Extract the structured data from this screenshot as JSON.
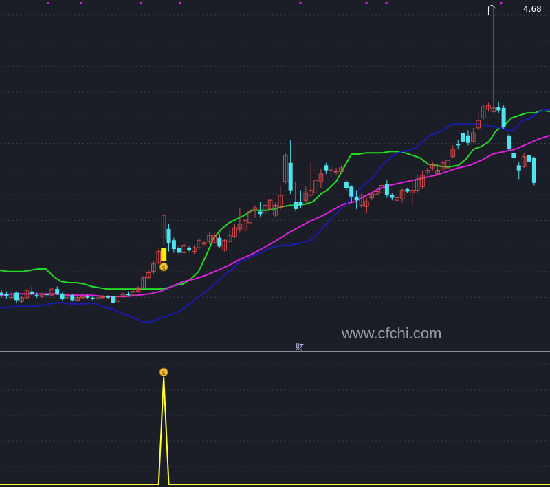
{
  "chart_data": [
    {
      "type": "candlestick",
      "panel": "main",
      "colors": {
        "up": "#d24a4a",
        "down": "#4fe3f0",
        "upper_band": "#22dd22",
        "middle_band": "#e020e0",
        "lower_band": "#1a1ab8",
        "signal_bar": "#ffee00",
        "marker_dots": "#e020e0"
      },
      "candles": [
        [
          2.4,
          2.38,
          2.42,
          2.36
        ],
        [
          2.39,
          2.37,
          2.41,
          2.35
        ],
        [
          2.36,
          2.39,
          2.4,
          2.35
        ],
        [
          2.4,
          2.34,
          2.41,
          2.32
        ],
        [
          2.33,
          2.36,
          2.37,
          2.32
        ],
        [
          2.36,
          2.42,
          2.43,
          2.35
        ],
        [
          2.41,
          2.39,
          2.45,
          2.37
        ],
        [
          2.38,
          2.37,
          2.4,
          2.36
        ],
        [
          2.37,
          2.39,
          2.4,
          2.36
        ],
        [
          2.39,
          2.38,
          2.41,
          2.37
        ],
        [
          2.38,
          2.43,
          2.44,
          2.37
        ],
        [
          2.43,
          2.39,
          2.45,
          2.38
        ],
        [
          2.39,
          2.35,
          2.4,
          2.34
        ],
        [
          2.36,
          2.38,
          2.39,
          2.35
        ],
        [
          2.38,
          2.34,
          2.39,
          2.33
        ],
        [
          2.34,
          2.36,
          2.37,
          2.33
        ],
        [
          2.36,
          2.37,
          2.38,
          2.35
        ],
        [
          2.37,
          2.36,
          2.38,
          2.35
        ],
        [
          2.36,
          2.35,
          2.37,
          2.34
        ],
        [
          2.35,
          2.36,
          2.37,
          2.34
        ],
        [
          2.36,
          2.37,
          2.38,
          2.35
        ],
        [
          2.37,
          2.36,
          2.38,
          2.35
        ],
        [
          2.37,
          2.32,
          2.38,
          2.31
        ],
        [
          2.33,
          2.37,
          2.38,
          2.32
        ],
        [
          2.37,
          2.39,
          2.4,
          2.36
        ],
        [
          2.39,
          2.38,
          2.41,
          2.37
        ],
        [
          2.38,
          2.41,
          2.42,
          2.37
        ],
        [
          2.41,
          2.44,
          2.45,
          2.4
        ],
        [
          2.44,
          2.52,
          2.53,
          2.43
        ],
        [
          2.52,
          2.56,
          2.58,
          2.51
        ],
        [
          2.57,
          2.63,
          2.65,
          2.55
        ],
        [
          2.64,
          2.73,
          2.75,
          2.63
        ],
        [
          2.83,
          3.02,
          3.04,
          2.78
        ],
        [
          2.91,
          2.8,
          2.95,
          2.73
        ],
        [
          2.82,
          2.75,
          2.84,
          2.72
        ],
        [
          2.76,
          2.72,
          2.78,
          2.7
        ],
        [
          2.72,
          2.78,
          2.8,
          2.71
        ],
        [
          2.76,
          2.74,
          2.77,
          2.73
        ],
        [
          2.73,
          2.76,
          2.78,
          2.71
        ],
        [
          2.76,
          2.82,
          2.84,
          2.74
        ],
        [
          2.79,
          2.8,
          2.81,
          2.78
        ],
        [
          2.81,
          2.86,
          2.88,
          2.79
        ],
        [
          2.8,
          2.86,
          2.88,
          2.79
        ],
        [
          2.84,
          2.77,
          2.87,
          2.76
        ],
        [
          2.74,
          2.82,
          2.83,
          2.73
        ],
        [
          2.81,
          2.86,
          2.9,
          2.8
        ],
        [
          2.85,
          2.92,
          2.95,
          2.84
        ],
        [
          2.91,
          2.95,
          3.08,
          2.88
        ],
        [
          2.9,
          2.98,
          2.99,
          2.9
        ],
        [
          2.96,
          3.05,
          3.08,
          2.94
        ],
        [
          3.06,
          3.08,
          3.1,
          3.0
        ],
        [
          3.05,
          3.03,
          3.13,
          3.01
        ],
        [
          3.04,
          3.1,
          3.11,
          3.03
        ],
        [
          3.07,
          3.14,
          3.15,
          3.06
        ],
        [
          3.02,
          3.1,
          3.12,
          3.01
        ],
        [
          3.08,
          3.18,
          3.25,
          3.06
        ],
        [
          3.29,
          3.5,
          3.52,
          3.27
        ],
        [
          3.44,
          3.22,
          3.62,
          3.19
        ],
        [
          3.13,
          3.07,
          3.29,
          3.05
        ],
        [
          3.13,
          3.1,
          3.22,
          3.08
        ],
        [
          3.14,
          3.2,
          3.25,
          3.12
        ],
        [
          3.18,
          3.22,
          3.45,
          3.16
        ],
        [
          3.2,
          3.3,
          3.44,
          3.19
        ],
        [
          3.29,
          3.35,
          3.39,
          3.24
        ],
        [
          3.42,
          3.38,
          3.44,
          3.35
        ],
        [
          3.38,
          3.39,
          3.42,
          3.32
        ],
        [
          3.36,
          3.37,
          3.4,
          3.34
        ],
        [
          3.37,
          3.4,
          3.42,
          3.35
        ],
        [
          3.29,
          3.24,
          3.3,
          3.22
        ],
        [
          3.25,
          3.17,
          3.26,
          3.12
        ],
        [
          3.17,
          3.14,
          3.22,
          3.07
        ],
        [
          3.1,
          3.18,
          3.2,
          3.08
        ],
        [
          3.09,
          3.13,
          3.16,
          3.04
        ],
        [
          3.16,
          3.19,
          3.2,
          3.14
        ],
        [
          3.19,
          3.21,
          3.22,
          3.18
        ],
        [
          3.2,
          3.26,
          3.28,
          3.19
        ],
        [
          3.27,
          3.18,
          3.3,
          3.16
        ],
        [
          3.18,
          3.16,
          3.2,
          3.14
        ],
        [
          3.14,
          3.16,
          3.18,
          3.12
        ],
        [
          3.15,
          3.22,
          3.24,
          3.12
        ],
        [
          3.23,
          3.21,
          3.24,
          3.2
        ],
        [
          3.2,
          3.22,
          3.3,
          3.1
        ],
        [
          3.22,
          3.31,
          3.35,
          3.2
        ],
        [
          3.25,
          3.34,
          3.38,
          3.23
        ],
        [
          3.36,
          3.38,
          3.4,
          3.34
        ],
        [
          3.4,
          3.43,
          3.45,
          3.38
        ],
        [
          3.35,
          3.38,
          3.43,
          3.34
        ],
        [
          3.39,
          3.44,
          3.47,
          3.38
        ],
        [
          3.4,
          3.46,
          3.48,
          3.39
        ],
        [
          3.49,
          3.55,
          3.58,
          3.48
        ],
        [
          3.59,
          3.58,
          3.62,
          3.55
        ],
        [
          3.68,
          3.61,
          3.7,
          3.6
        ],
        [
          3.66,
          3.6,
          3.7,
          3.58
        ],
        [
          3.61,
          3.68,
          3.72,
          3.6
        ],
        [
          3.72,
          3.78,
          3.84,
          3.7
        ],
        [
          3.8,
          3.89,
          3.9,
          3.78
        ],
        [
          3.87,
          3.9,
          3.92,
          3.85
        ],
        [
          3.85,
          3.88,
          4.68,
          3.84
        ],
        [
          3.89,
          3.86,
          3.93,
          3.84
        ],
        [
          3.88,
          3.73,
          3.9,
          3.71
        ],
        [
          3.66,
          3.55,
          3.67,
          3.54
        ],
        [
          3.52,
          3.48,
          3.57,
          3.45
        ],
        [
          3.42,
          3.38,
          3.45,
          3.31
        ],
        [
          3.41,
          3.49,
          3.52,
          3.4
        ],
        [
          3.5,
          3.45,
          3.52,
          3.25
        ],
        [
          3.48,
          3.28,
          3.49,
          3.26
        ]
      ],
      "upper_band": [
        2.58,
        2.57,
        2.57,
        2.57,
        2.58,
        2.59,
        2.59,
        2.53,
        2.49,
        2.48,
        2.48,
        2.47,
        2.45,
        2.44,
        2.43,
        2.43,
        2.43,
        2.43,
        2.43,
        2.43,
        2.43,
        2.43,
        2.44,
        2.46,
        2.47,
        2.51,
        2.57,
        2.7,
        2.84,
        2.91,
        2.96,
        2.99,
        3.02,
        3.06,
        3.06,
        3.06,
        3.07,
        3.09,
        3.1,
        3.1,
        3.11,
        3.13,
        3.19,
        3.23,
        3.29,
        3.4,
        3.51,
        3.51,
        3.52,
        3.52,
        3.52,
        3.53,
        3.53,
        3.52,
        3.5,
        3.48,
        3.43,
        3.42,
        3.41,
        3.41,
        3.42,
        3.47,
        3.55,
        3.57,
        3.61,
        3.7,
        3.74,
        3.8,
        3.82,
        3.84,
        3.84,
        3.86,
        3.85
      ],
      "middle_band": [
        2.38,
        2.39,
        2.39,
        2.39,
        2.39,
        2.39,
        2.38,
        2.38,
        2.38,
        2.37,
        2.37,
        2.37,
        2.38,
        2.39,
        2.41,
        2.45,
        2.49,
        2.51,
        2.54,
        2.58,
        2.62,
        2.67,
        2.71,
        2.76,
        2.81,
        2.87,
        2.92,
        2.97,
        3.01,
        3.06,
        3.11,
        3.13,
        3.18,
        3.23,
        3.26,
        3.28,
        3.3,
        3.32,
        3.34,
        3.37,
        3.4,
        3.42,
        3.46,
        3.51,
        3.53,
        3.55,
        3.59,
        3.63,
        3.66
      ],
      "lower_band": [
        2.28,
        2.28,
        2.29,
        2.29,
        2.29,
        2.29,
        2.3,
        2.31,
        2.32,
        2.32,
        2.31,
        2.31,
        2.31,
        2.32,
        2.3,
        2.28,
        2.27,
        2.24,
        2.22,
        2.2,
        2.17,
        2.16,
        2.18,
        2.2,
        2.22,
        2.24,
        2.27,
        2.31,
        2.36,
        2.4,
        2.45,
        2.5,
        2.55,
        2.59,
        2.65,
        2.67,
        2.7,
        2.72,
        2.75,
        2.77,
        2.78,
        2.78,
        2.79,
        2.8,
        2.82,
        2.87,
        2.93,
        3.0,
        3.05,
        3.1,
        3.17,
        3.23,
        3.28,
        3.33,
        3.41,
        3.46,
        3.51,
        3.53,
        3.54,
        3.56,
        3.61,
        3.66,
        3.68,
        3.71,
        3.75,
        3.75,
        3.75,
        3.75,
        3.75,
        3.74,
        3.73,
        3.72,
        3.7,
        3.7,
        3.78,
        3.79,
        3.83,
        3.86,
        3.87
      ],
      "highlight_label": "4.68",
      "signal_index": 32,
      "watermark": "www.cfchi.com"
    },
    {
      "type": "line",
      "panel": "indicator",
      "label": "财",
      "signal_index": 32,
      "values_note_free": true,
      "values": [
        0,
        0,
        0,
        0,
        0,
        0,
        0,
        0,
        0,
        0,
        0,
        0,
        0,
        0,
        0,
        0,
        0,
        0,
        0,
        0,
        0,
        0,
        0,
        0,
        0,
        0,
        0,
        0,
        0,
        0,
        0,
        0,
        1,
        0,
        0,
        0,
        0,
        0,
        0,
        0,
        0,
        0,
        0,
        0,
        0,
        0,
        0,
        0,
        0,
        0,
        0,
        0,
        0,
        0,
        0,
        0,
        0,
        0,
        0,
        0,
        0,
        0,
        0,
        0,
        0,
        0,
        0,
        0,
        0,
        0,
        0,
        0,
        0,
        0,
        0,
        0,
        0,
        0,
        0,
        0,
        0,
        0,
        0,
        0,
        0,
        0,
        0,
        0,
        0,
        0,
        0,
        0,
        0,
        0,
        0,
        0,
        0,
        0,
        0,
        0,
        0,
        0,
        0,
        0,
        0,
        0,
        0
      ],
      "color": "#ffff33"
    }
  ]
}
